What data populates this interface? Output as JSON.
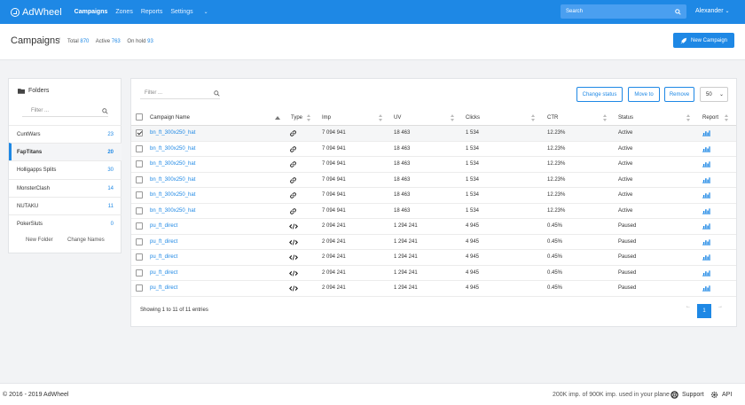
{
  "app": {
    "name": "AdWheel"
  },
  "nav": {
    "items": [
      {
        "label": "Campaigns",
        "active": true
      },
      {
        "label": "Zones",
        "active": false
      },
      {
        "label": "Reports",
        "active": false
      },
      {
        "label": "Settings",
        "active": false,
        "dropdown": true
      }
    ],
    "search_placeholder": "Search",
    "user_name": "Alexander"
  },
  "header": {
    "title": "Campaigns",
    "separator": "/",
    "total_label": "Total",
    "total_value": "870",
    "active_label": "Active",
    "active_value": "763",
    "onhold_label": "On hold",
    "onhold_value": "93",
    "new_campaign_label": "New Campaign"
  },
  "folders": {
    "title": "Folders",
    "filter_placeholder": "Filter ...",
    "items": [
      {
        "name": "CuntWars",
        "count": "23",
        "selected": false
      },
      {
        "name": "FapTitans",
        "count": "20",
        "selected": true
      },
      {
        "name": "Holligapps Splits",
        "count": "30",
        "selected": false
      },
      {
        "name": "MonsterClash",
        "count": "14",
        "selected": false
      },
      {
        "name": "NUTAKU",
        "count": "11",
        "selected": false
      },
      {
        "name": "PokerSluts",
        "count": "0",
        "selected": false
      }
    ],
    "new_folder_label": "New Folder",
    "change_names_label": "Change Names"
  },
  "table": {
    "filter_placeholder": "Filter ...",
    "change_status_label": "Change status",
    "move_to_label": "Move to",
    "remove_label": "Remove",
    "page_size": "50",
    "columns": [
      "Campaign Name",
      "Type",
      "Imp",
      "UV",
      "Clicks",
      "CTR",
      "Status",
      "Report"
    ],
    "rows": [
      {
        "name": "bn_ft_300x250_hat",
        "type": "link",
        "imp": "7 094 941",
        "uv": "18 463",
        "clicks": "1 534",
        "ctr": "12.23%",
        "status": "Active",
        "checked": true
      },
      {
        "name": "bn_ft_300x250_hat",
        "type": "link",
        "imp": "7 094 941",
        "uv": "18 463",
        "clicks": "1 534",
        "ctr": "12.23%",
        "status": "Active",
        "checked": false
      },
      {
        "name": "bn_ft_300x250_hat",
        "type": "link",
        "imp": "7 094 941",
        "uv": "18 463",
        "clicks": "1 534",
        "ctr": "12.23%",
        "status": "Active",
        "checked": false
      },
      {
        "name": "bn_ft_300x250_hat",
        "type": "link",
        "imp": "7 094 941",
        "uv": "18 463",
        "clicks": "1 534",
        "ctr": "12.23%",
        "status": "Active",
        "checked": false
      },
      {
        "name": "bn_ft_300x250_hat",
        "type": "link",
        "imp": "7 094 941",
        "uv": "18 463",
        "clicks": "1 534",
        "ctr": "12.23%",
        "status": "Active",
        "checked": false
      },
      {
        "name": "bn_ft_300x250_hat",
        "type": "link",
        "imp": "7 094 941",
        "uv": "18 463",
        "clicks": "1 534",
        "ctr": "12.23%",
        "status": "Active",
        "checked": false
      },
      {
        "name": "pu_ft_direct",
        "type": "code",
        "imp": "2 094 241",
        "uv": "1 294 241",
        "clicks": "4 945",
        "ctr": "0.45%",
        "status": "Paused",
        "checked": false
      },
      {
        "name": "pu_ft_direct",
        "type": "code",
        "imp": "2 094 241",
        "uv": "1 294 241",
        "clicks": "4 945",
        "ctr": "0.45%",
        "status": "Paused",
        "checked": false
      },
      {
        "name": "pu_ft_direct",
        "type": "code",
        "imp": "2 094 241",
        "uv": "1 294 241",
        "clicks": "4 945",
        "ctr": "0.45%",
        "status": "Paused",
        "checked": false
      },
      {
        "name": "pu_ft_direct",
        "type": "code",
        "imp": "2 094 241",
        "uv": "1 294 241",
        "clicks": "4 945",
        "ctr": "0.45%",
        "status": "Paused",
        "checked": false
      },
      {
        "name": "pu_ft_direct",
        "type": "code",
        "imp": "2 094 241",
        "uv": "1 294 241",
        "clicks": "4 945",
        "ctr": "0.45%",
        "status": "Paused",
        "checked": false
      }
    ],
    "showing_text": "Showing 1 to 11 of 11 entries",
    "pager": {
      "prev": "←",
      "current": "1",
      "next": "→"
    }
  },
  "footer": {
    "copyright": "© 2016 - 2019 AdWheel",
    "usage": "200K imp. of 900K imp. used in your plane",
    "support_label": "Support",
    "api_label": "API"
  },
  "colors": {
    "primary": "#1e88e5",
    "background": "#f2f3f5"
  }
}
